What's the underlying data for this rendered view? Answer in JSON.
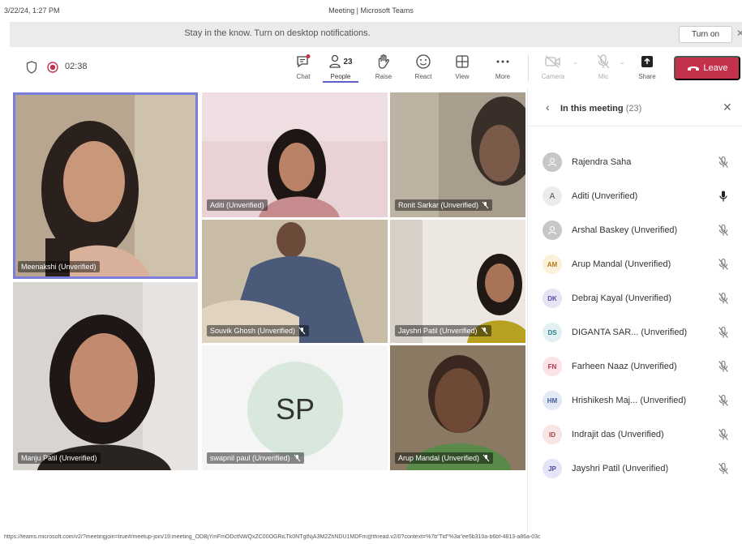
{
  "print_header": {
    "datetime": "3/22/24, 1:27 PM",
    "title": "Meeting | Microsoft Teams"
  },
  "notification": {
    "message": "Stay in the know. Turn on desktop notifications.",
    "turn_on_label": "Turn on",
    "close_glyph": "✕"
  },
  "toolbar": {
    "timer": "02:38",
    "people_count": "23",
    "buttons": {
      "chat": "Chat",
      "people": "People",
      "raise": "Raise",
      "react": "React",
      "view": "View",
      "more": "More",
      "camera": "Camera",
      "mic": "Mic",
      "share": "Share"
    },
    "leave_label": "Leave"
  },
  "tiles": [
    {
      "name": "Meenakshi (Unverified)"
    },
    {
      "name": "Aditi (Unverified)"
    },
    {
      "name": "Ronit Sarkar (Unverified)"
    },
    {
      "name": "Souvik Ghosh (Unverified)"
    },
    {
      "name": "Jayshri Patil (Unverified)"
    },
    {
      "name": "Manju Patil (Unverified)"
    },
    {
      "name": "swapnil paul (Unverified)",
      "initials": "SP"
    },
    {
      "name": "Arup Mandal (Unverified)"
    }
  ],
  "panel": {
    "title": "In this meeting",
    "count": "(23)",
    "participants": [
      {
        "name": "Rajendra Saha",
        "avatar": "",
        "avatar_bg": "#c7c7c7",
        "avatar_fg": "#ffffff"
      },
      {
        "name": "Aditi (Unverified)",
        "avatar": "A",
        "avatar_bg": "#ececec",
        "avatar_fg": "#555555"
      },
      {
        "name": "Arshal Baskey (Unverified)",
        "avatar": "",
        "avatar_bg": "#c7c7c7",
        "avatar_fg": "#ffffff"
      },
      {
        "name": "Arup Mandal (Unverified)",
        "avatar": "AM",
        "avatar_bg": "#fdf0d8",
        "avatar_fg": "#b07a1a"
      },
      {
        "name": "Debraj Kayal (Unverified)",
        "avatar": "DK",
        "avatar_bg": "#e7e4f6",
        "avatar_fg": "#5b4a9e"
      },
      {
        "name": "DIGANTA SAR...  (Unverified)",
        "avatar": "DS",
        "avatar_bg": "#e2f1f4",
        "avatar_fg": "#2f7c8a"
      },
      {
        "name": "Farheen Naaz (Unverified)",
        "avatar": "FN",
        "avatar_bg": "#fbe3e6",
        "avatar_fg": "#b5344a"
      },
      {
        "name": "Hrishikesh Maj...  (Unverified)",
        "avatar": "HM",
        "avatar_bg": "#e3e9f7",
        "avatar_fg": "#3e5b9a"
      },
      {
        "name": "Indrajit das (Unverified)",
        "avatar": "ID",
        "avatar_bg": "#f7e4e4",
        "avatar_fg": "#a04444"
      },
      {
        "name": "Jayshri Patil (Unverified)",
        "avatar": "JP",
        "avatar_bg": "#e6e4f7",
        "avatar_fg": "#4a45a0"
      }
    ]
  },
  "status_url": "https://teams.microsoft.com/v2/?meetingjoin=true#/meetup-join/19:meeting_ODBjYmFmODctNWQxZC00OGRiLTk0NTgtNjA3M2ZhNDU1MDFm@thread.v2/0?context=%7b\"Tid\"%3a\"ee5b310a-b6bf-4813-a86a-03c",
  "colors": {
    "accent": "#5b5fc7",
    "leave": "#c4314b",
    "record": "#c4314b"
  }
}
